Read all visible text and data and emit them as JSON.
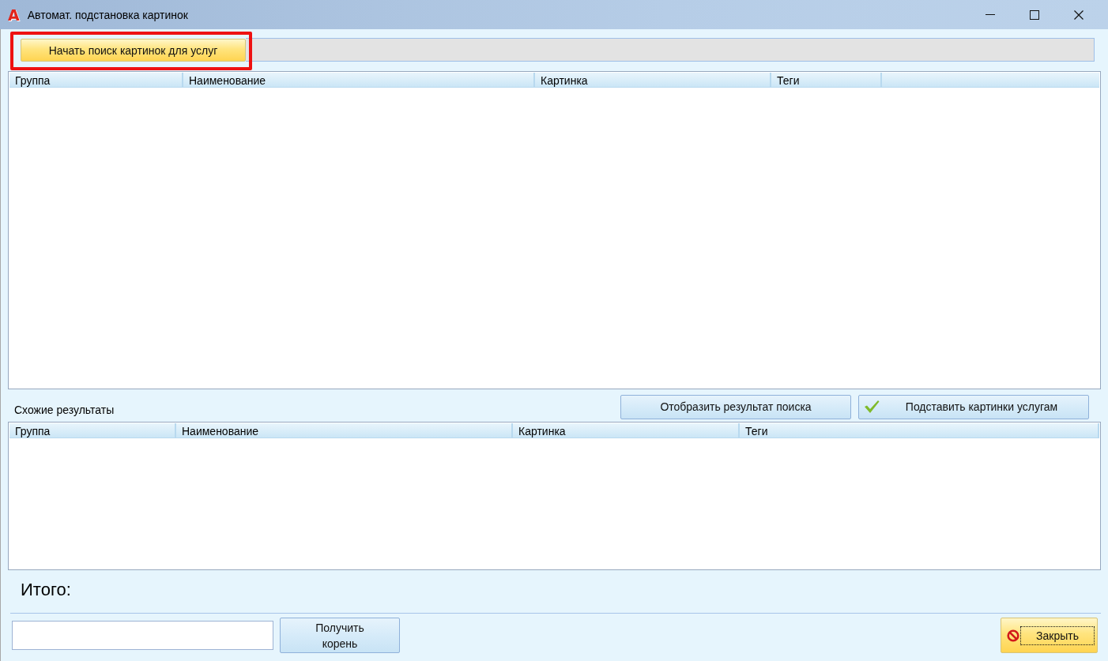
{
  "window": {
    "logo": "A",
    "title": "Автомат. подстановка картинок"
  },
  "toolbar": {
    "start_button": {
      "label": "Начать поиск картинок для услуг",
      "highlighted": true
    }
  },
  "main_table": {
    "columns": [
      "Группа",
      "Наименование",
      "Картинка",
      "Теги"
    ]
  },
  "similar": {
    "label": "Схожие результаты",
    "buttons": [
      {
        "label": "Отобразить результат поиска",
        "kind": "plain"
      },
      {
        "label": "Подставить картинки услугам",
        "kind": "check"
      }
    ]
  },
  "similar_table": {
    "columns": [
      "Группа",
      "Наименование",
      "Картинка",
      "Теги"
    ]
  },
  "total": {
    "label": "Итого:"
  },
  "footer": {
    "root_button": {
      "label": "Получить корень"
    },
    "close_button": {
      "label": "Закрыть",
      "focused": true
    }
  }
}
